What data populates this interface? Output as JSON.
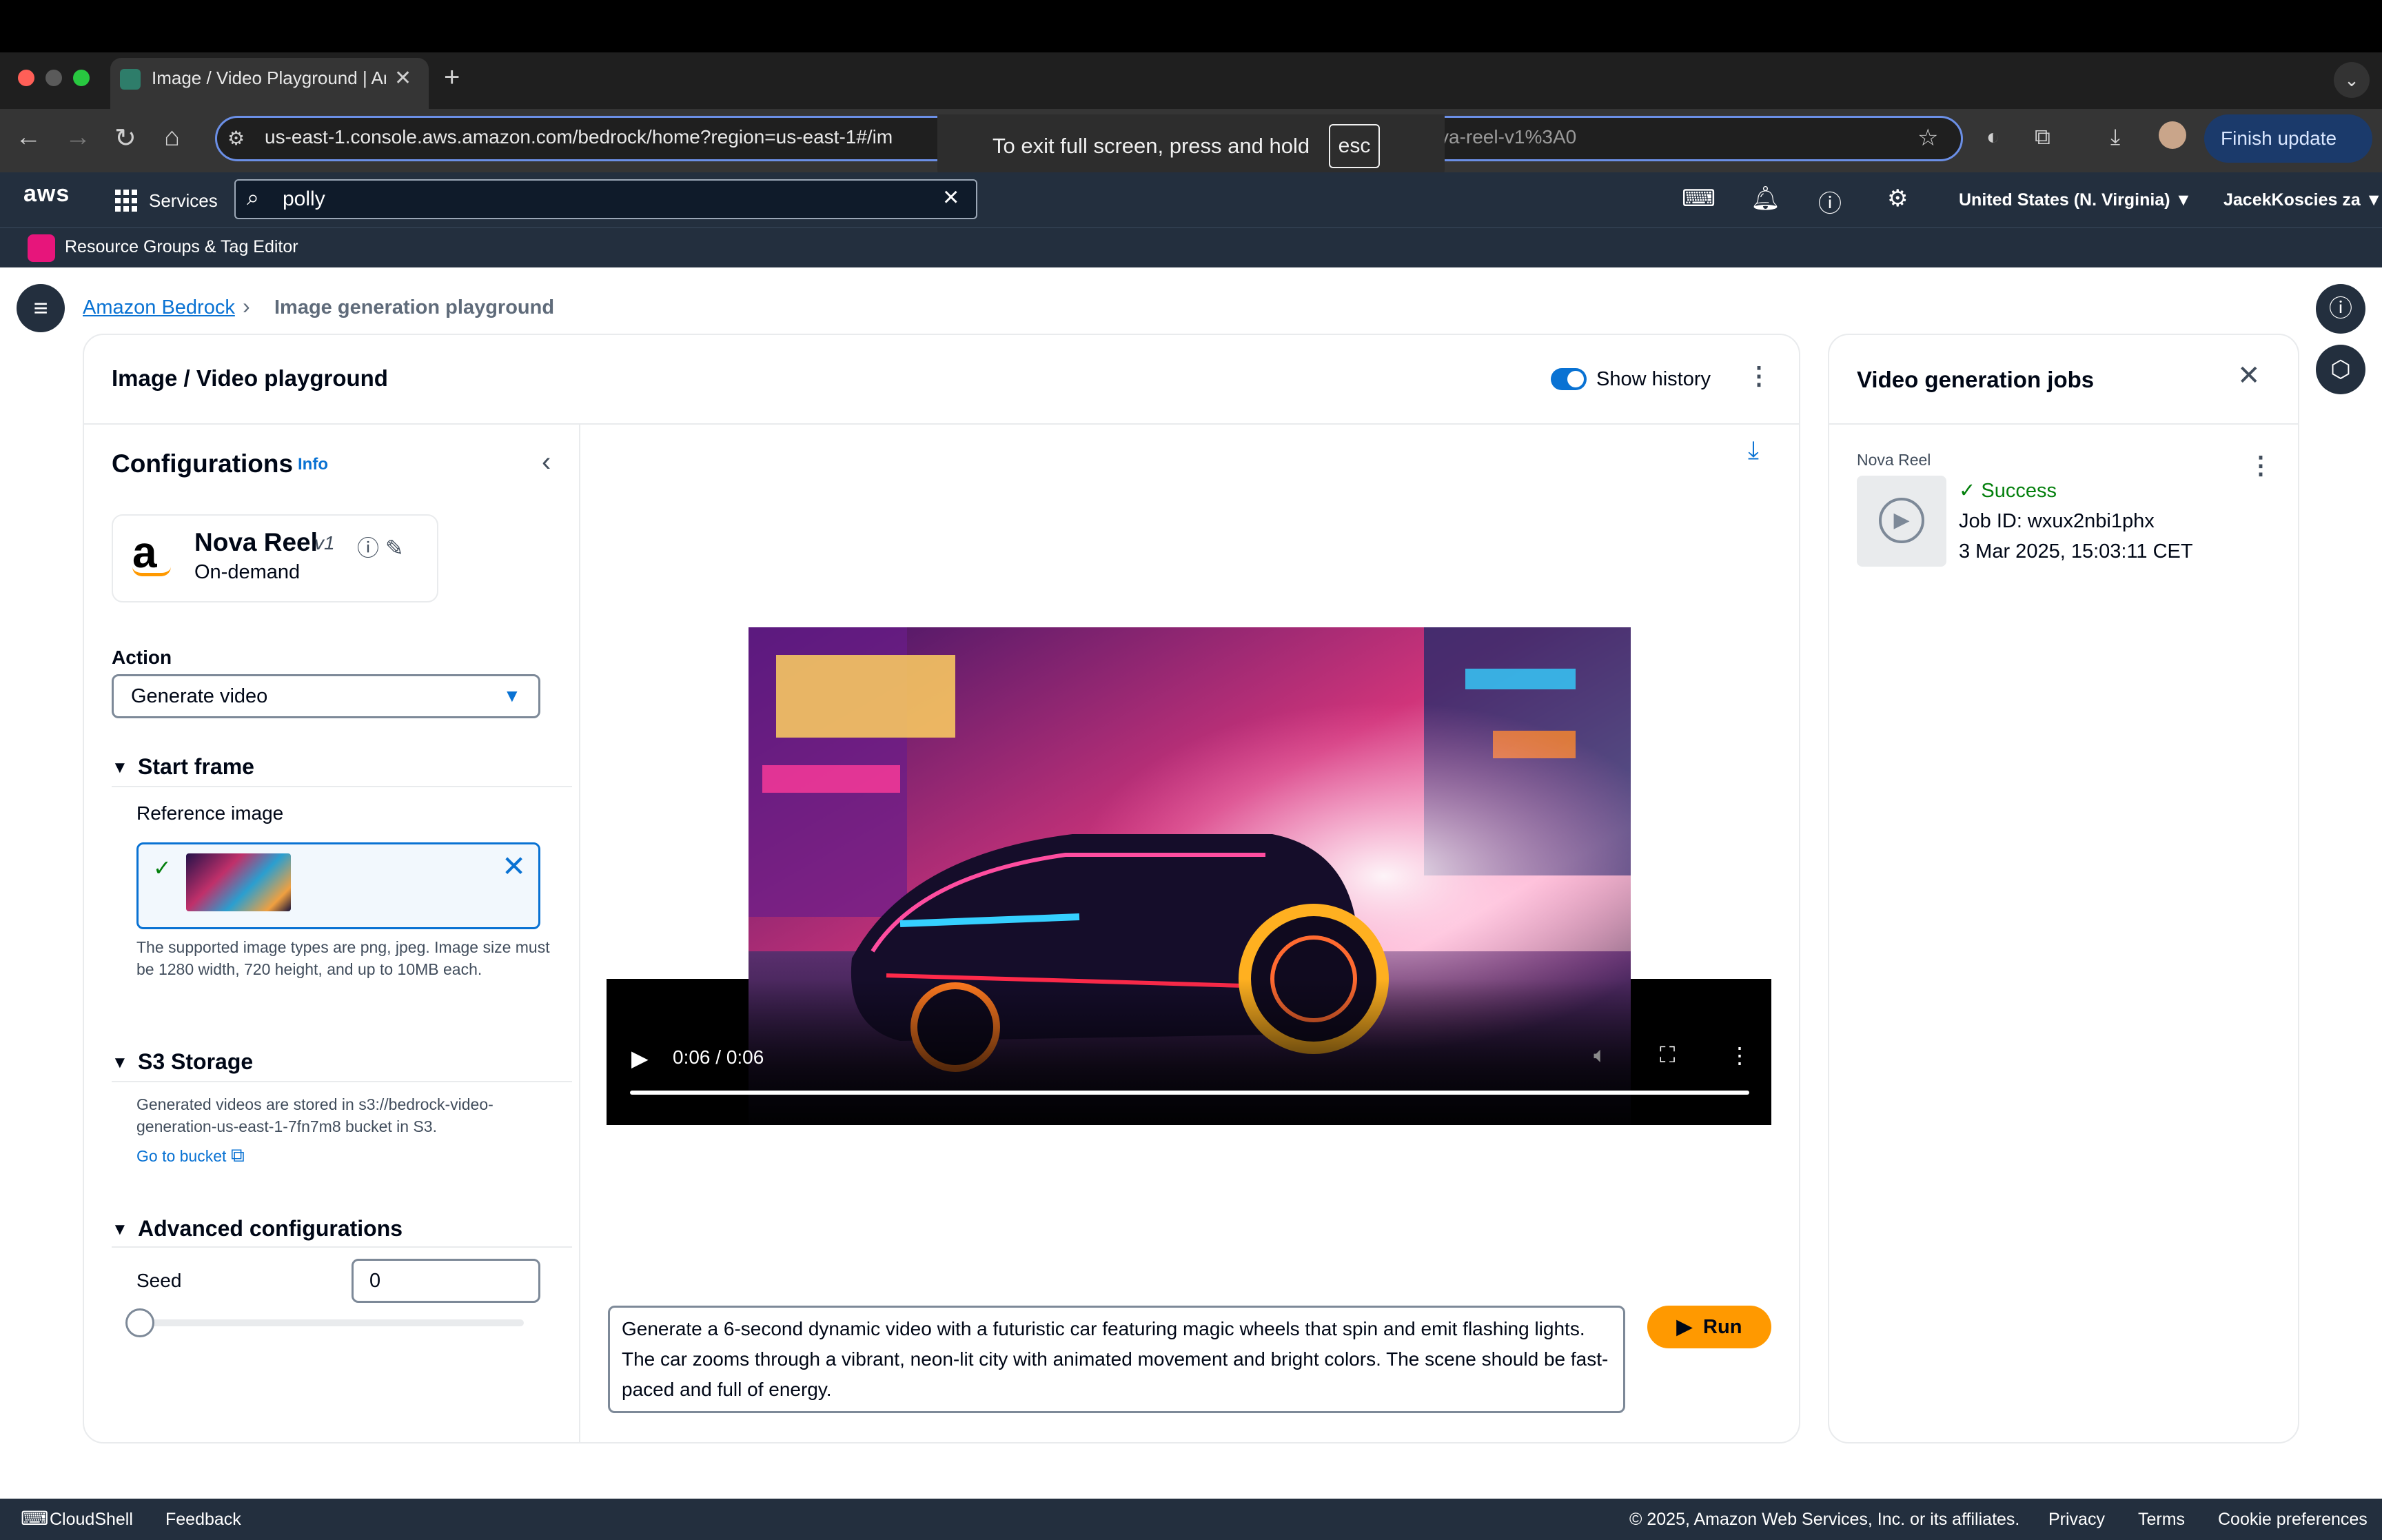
{
  "browser": {
    "tab_title": "Image / Video Playground | Am",
    "new_tab": "+",
    "url_visible": "us-east-1.console.aws.amazon.com/bedrock/home?region=us-east-1#/im",
    "url_tail": "va-reel-v1%3A0",
    "fullscreen_msg": "To exit full screen, press and hold",
    "fullscreen_key": "esc",
    "finish_update": "Finish update"
  },
  "aws_header": {
    "logo": "aws",
    "services": "Services",
    "search_value": "polly",
    "region": "United States (N. Virginia) ▼",
    "user": "JacekKoscies za ▼",
    "favorite": "Resource Groups & Tag Editor"
  },
  "breadcrumb": {
    "root": "Amazon Bedrock",
    "current": "Image generation playground"
  },
  "playground": {
    "title": "Image / Video playground",
    "show_history": "Show history"
  },
  "config": {
    "title": "Configurations",
    "info": "Info",
    "model_name": "Nova Reel",
    "model_version": "v1",
    "model_mode": "On-demand",
    "action_label": "Action",
    "action_value": "Generate video",
    "start_frame": "Start frame",
    "reference_image": "Reference image",
    "upload_hint": "The supported image types are png, jpeg. Image size must be 1280 width, 720 height, and up to 10MB each.",
    "s3_title": "S3 Storage",
    "s3_hint": "Generated videos are stored in s3://bedrock-video-generation-us-east-1-7fn7m8 bucket in S3.",
    "go_to_bucket": "Go to bucket",
    "advanced_title": "Advanced configurations",
    "seed_label": "Seed",
    "seed_value": "0"
  },
  "video": {
    "time": "0:06 / 0:06",
    "progress": 1.0
  },
  "prompt": {
    "text": "Generate a 6-second dynamic video with a futuristic car featuring magic wheels that spin and emit flashing lights. The car zooms through a vibrant, neon-lit city with animated movement and bright colors. The scene should be fast-paced and full of energy.",
    "run": "Run"
  },
  "jobs": {
    "title": "Video generation jobs",
    "model": "Nova Reel",
    "status": "Success",
    "job_id": "Job ID: wxux2nbi1phx",
    "date": "3 Mar 2025, 15:03:11 CET"
  },
  "footer": {
    "cloudshell": "CloudShell",
    "feedback": "Feedback",
    "copyright": "© 2025, Amazon Web Services, Inc. or its affiliates.",
    "privacy": "Privacy",
    "terms": "Terms",
    "cookies": "Cookie preferences"
  },
  "colors": {
    "aws_nav": "#232f3e",
    "link_blue": "#0972d3",
    "run_orange": "#ff9900",
    "success_green": "#037f0c"
  }
}
